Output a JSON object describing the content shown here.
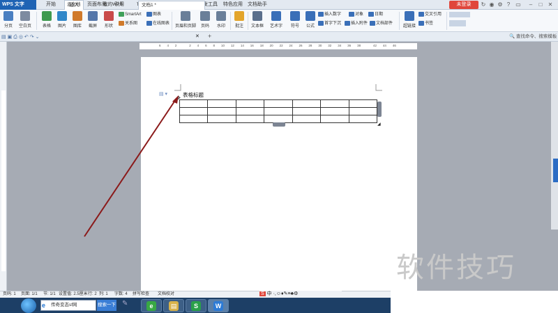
{
  "app": {
    "name": "WPS 文字",
    "login": "未登录"
  },
  "menu": {
    "tabs": [
      "开始",
      "插入",
      "页面布局",
      "引用",
      "审阅",
      "视图",
      "章节",
      "开发工具",
      "特色应用",
      "文档助手"
    ],
    "active_index": 1
  },
  "ribbon": {
    "groups": [
      {
        "label": "分页",
        "icon": "page-break-icon",
        "color": "#4a7fc1"
      },
      {
        "label": "空白页",
        "icon": "blank-page-icon",
        "color": "#7d8ba0"
      },
      {
        "label": "表格",
        "icon": "table-icon",
        "color": "#3f9a4f"
      },
      {
        "label": "图片",
        "icon": "picture-icon",
        "color": "#2e86c9"
      },
      {
        "label": "图库",
        "icon": "gallery-icon",
        "color": "#d07a2b"
      },
      {
        "label": "截屏",
        "icon": "screenshot-icon",
        "color": "#5577aa"
      },
      {
        "label": "形状",
        "icon": "shape-icon",
        "color": "#c94a4a"
      },
      {
        "label": "页眉和页脚",
        "icon": "header-footer-icon",
        "color": "#6a7f99"
      },
      {
        "label": "页码",
        "icon": "page-number-icon",
        "color": "#6a7f99"
      },
      {
        "label": "水印",
        "icon": "watermark-icon",
        "color": "#6a7f99"
      },
      {
        "label": "批注",
        "icon": "comment-icon",
        "color": "#e3a52b"
      },
      {
        "label": "文本框",
        "icon": "textbox-icon",
        "color": "#5a6f8c"
      },
      {
        "label": "艺术字",
        "icon": "wordart-icon",
        "color": "#3a6fb8"
      },
      {
        "label": "符号",
        "icon": "symbol-icon",
        "color": "#3a6fb8"
      },
      {
        "label": "公式",
        "icon": "formula-icon",
        "color": "#3a6fb8"
      },
      {
        "label": "超链接",
        "icon": "hyperlink-icon",
        "color": "#3a6fb8"
      },
      {
        "label": "书签",
        "icon": "bookmark-icon",
        "color": "#3a6fb8"
      }
    ],
    "small_items": {
      "smartart": "SmartArt",
      "chart": "图表",
      "relation": "关系图",
      "online_chart": "在线图表",
      "insert_number": "插入数字",
      "object": "对象",
      "first_drop": "首字下沉",
      "attach": "插入附件",
      "date": "日期",
      "doc_part": "文档部件",
      "cross_ref": "交叉引用"
    }
  },
  "tabs": {
    "items": [
      "云文档",
      "我的WPS",
      "文档1 *"
    ],
    "search_placeholder": "查找命令、搜索模板"
  },
  "ruler": {
    "marks": [
      "6",
      "4",
      "2",
      "",
      "2",
      "4",
      "6",
      "8",
      "10",
      "12",
      "14",
      "16",
      "18",
      "20",
      "22",
      "24",
      "26",
      "28",
      "30",
      "32",
      "34",
      "36",
      "38",
      "",
      "42",
      "44",
      "46"
    ]
  },
  "document": {
    "table_title": "表格标题",
    "table_rows": 3,
    "table_cols": 7
  },
  "status": {
    "items": [
      "页码: 1",
      "页面: 1/1",
      "节: 1/1",
      "设置值: 2.5厘米",
      "行: 2",
      "列: 1",
      "字数: 4",
      "拼写检查",
      "文档校对"
    ]
  },
  "taskbar": {
    "search_text": "传奇变态sf网",
    "search_button": "搜索一下"
  },
  "ime": {
    "label": "中"
  },
  "watermark": {
    "text": "软件技巧"
  },
  "colors": {
    "accent": "#1f63b4",
    "arrow": "#8b1a1a",
    "login": "#e0463b"
  }
}
